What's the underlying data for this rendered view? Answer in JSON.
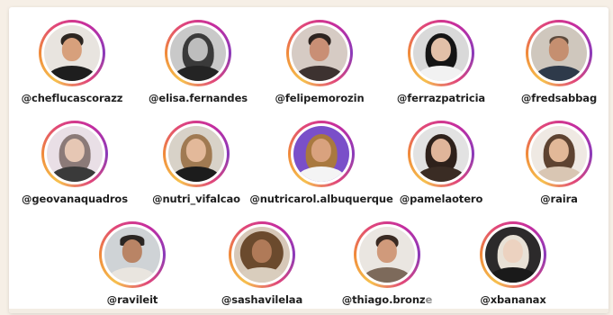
{
  "profiles": [
    {
      "handle": "@cheflucascorazz",
      "bg": "#e8e4df",
      "skin": "#d7a07c",
      "hair": "#2d2621",
      "shirt": "#1e1e1e",
      "hair_style": "short"
    },
    {
      "handle": "@elisa.fernandes",
      "bg": "#c9c9c9",
      "skin": "#bdbdbd",
      "hair": "#3a3a3a",
      "shirt": "#242424",
      "hair_style": "long"
    },
    {
      "handle": "@felipemorozin",
      "bg": "#d6cbc4",
      "skin": "#c98f75",
      "hair": "#2e2420",
      "shirt": "#3d3230",
      "hair_style": "short"
    },
    {
      "handle": "@ferrazpatricia",
      "bg": "#d9d9d9",
      "skin": "#e2c0a8",
      "hair": "#151515",
      "shirt": "#f2f2f2",
      "hair_style": "long"
    },
    {
      "handle": "@fredsabbag",
      "bg": "#cfc7bd",
      "skin": "#c58f70",
      "hair": "#5d4a3c",
      "shirt": "#2e3a4a",
      "hair_style": "bald"
    },
    {
      "handle": "@geovanaquadros",
      "bg": "#e9dfe6",
      "skin": "#e6c7b4",
      "hair": "#8b7a78",
      "shirt": "#3a3a3a",
      "hair_style": "long"
    },
    {
      "handle": "@nutri_vifalcao",
      "bg": "#d8d2c8",
      "skin": "#e3b99a",
      "hair": "#a07a52",
      "shirt": "#1c1c1c",
      "hair_style": "long"
    },
    {
      "handle": "@nutricarol.albuquerque",
      "bg": "#7a4fc9",
      "skin": "#d9a27e",
      "hair": "#a9793f",
      "shirt": "#f4f4f4",
      "hair_style": "long"
    },
    {
      "handle": "@pamelaotero",
      "bg": "#e2e2e2",
      "skin": "#e0b59a",
      "hair": "#2e211b",
      "shirt": "#3a2c24",
      "hair_style": "long"
    },
    {
      "handle": "@raira",
      "bg": "#efe9e3",
      "skin": "#e2b898",
      "hair": "#5e4331",
      "shirt": "#d9c6b3",
      "hair_style": "long"
    },
    {
      "handle": "@ravileit",
      "bg": "#cfd3d6",
      "skin": "#b98465",
      "hair": "#2b2623",
      "shirt": "#e9e5df",
      "hair_style": "cap"
    },
    {
      "handle": "@sashavilelaa",
      "bg": "#d7c8b8",
      "skin": "#b07a58",
      "hair": "#6b4a2d",
      "shirt": "#d9cdbd",
      "hair_style": "curly"
    },
    {
      "handle": "@thiago.bronze",
      "bg": "#eae6e1",
      "skin": "#d09a7b",
      "hair": "#3a2a22",
      "shirt": "#7d6a5b",
      "hair_style": "short"
    },
    {
      "handle": "@xbananax",
      "bg": "#2c2a2b",
      "skin": "#ecd2c0",
      "hair": "#e8e1d6",
      "shirt": "#1a1a1a",
      "hair_style": "long"
    }
  ]
}
